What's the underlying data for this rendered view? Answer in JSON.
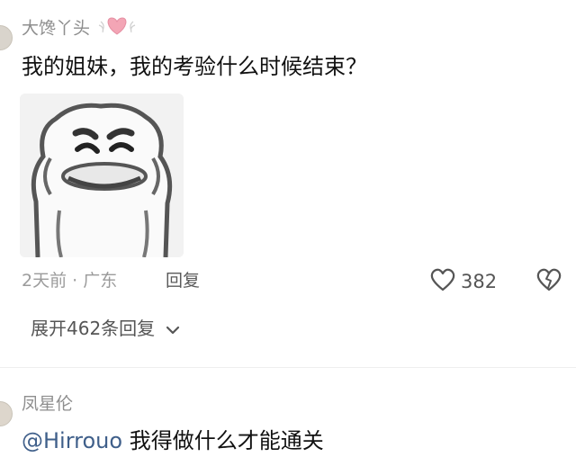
{
  "comment1": {
    "username": "大馋丫头",
    "badge_icon": "heart-badge-icon",
    "text": "我的姐妹，我的考验什么时候结束？",
    "sticker_icon": "meme-face-sticker",
    "meta": "2天前 · 广东",
    "reply_label": "回复",
    "like_icon": "heart-outline-icon",
    "like_count": "382",
    "dislike_icon": "broken-heart-icon",
    "expand_label": "展开462条回复",
    "expand_icon": "chevron-down-icon"
  },
  "comment2": {
    "username": "凤星伦",
    "mention": "@Hirrouo",
    "text": " 我得做什么才能通关"
  },
  "colors": {
    "badge": "#f3a5b5",
    "mention": "#3f5f8a",
    "meta": "#9b9b9b"
  }
}
